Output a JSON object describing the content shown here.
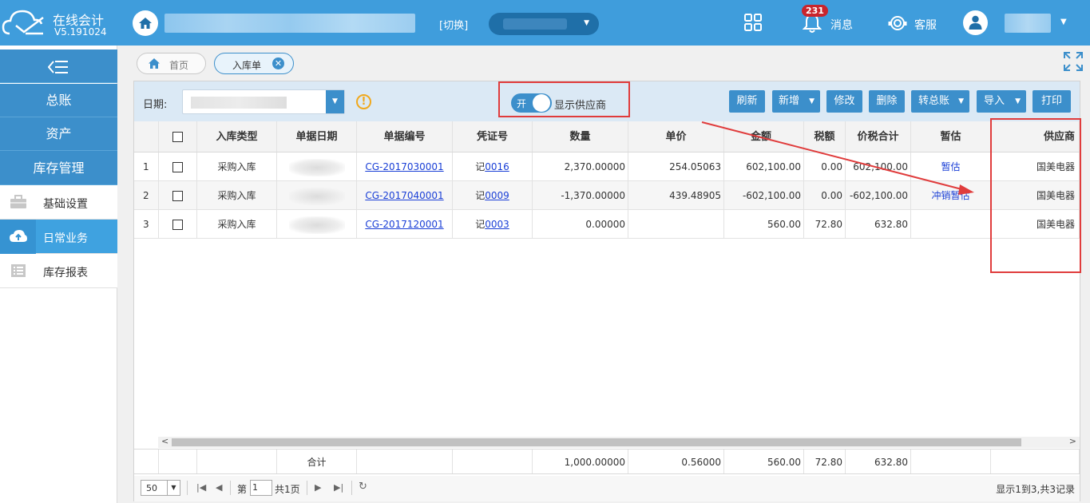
{
  "app": {
    "title": "在线会计",
    "version": "V5.191024"
  },
  "header": {
    "switch_label": "[切换]",
    "badge_count": "231",
    "messages_label": "消息",
    "service_label": "客服"
  },
  "sidebar": {
    "main_items": [
      "总账",
      "资产",
      "库存管理"
    ],
    "sub_items": [
      {
        "label": "基础设置",
        "icon": "briefcase-icon",
        "active": false
      },
      {
        "label": "日常业务",
        "icon": "cloud-upload-icon",
        "active": true
      },
      {
        "label": "库存报表",
        "icon": "report-list-icon",
        "active": false
      }
    ]
  },
  "tabs": [
    {
      "label": "首页",
      "icon": "home-icon"
    },
    {
      "label": "入库单",
      "active": true,
      "close_icon": "close-icon",
      "close_glyph": "✕"
    }
  ],
  "toolbar": {
    "date_label": "日期:",
    "warning_glyph": "!",
    "toggle_on_label": "开",
    "toggle_label": "显示供应商",
    "buttons": [
      {
        "label": "刷新"
      },
      {
        "label": "新增"
      },
      {
        "label": "修改"
      },
      {
        "label": "删除"
      },
      {
        "label": "转总账"
      },
      {
        "label": "导入"
      },
      {
        "label": "打印"
      }
    ]
  },
  "table": {
    "headers": [
      "入库类型",
      "单据日期",
      "单据编号",
      "凭证号",
      "数量",
      "单价",
      "金额",
      "税额",
      "价税合计",
      "暂估",
      "供应商"
    ],
    "rows": [
      {
        "num": "1",
        "type": "采购入库",
        "doc_no": "CG-2017030001",
        "voucher_prefix": "记",
        "voucher_no": "0016",
        "qty": "2,370.00000",
        "price": "254.05063",
        "amount": "602,100.00",
        "tax": "0.00",
        "total": "602,100.00",
        "estimate": "暂估",
        "supplier": "国美电器"
      },
      {
        "num": "2",
        "type": "采购入库",
        "doc_no": "CG-2017040001",
        "voucher_prefix": "记",
        "voucher_no": "0009",
        "qty": "-1,370.00000",
        "price": "439.48905",
        "amount": "-602,100.00",
        "tax": "0.00",
        "total": "-602,100.00",
        "estimate": "冲销暂估",
        "supplier": "国美电器"
      },
      {
        "num": "3",
        "type": "采购入库",
        "doc_no": "CG-2017120001",
        "voucher_prefix": "记",
        "voucher_no": "0003",
        "qty": "0.00000",
        "price": "",
        "amount": "560.00",
        "tax": "72.80",
        "total": "632.80",
        "estimate": "",
        "supplier": "国美电器"
      }
    ],
    "footer": {
      "label": "合计",
      "qty": "1,000.00000",
      "price": "0.56000",
      "amount": "560.00",
      "tax": "72.80",
      "total": "632.80"
    }
  },
  "pager": {
    "page_size": "50",
    "page_prefix": "第",
    "page_value": "1",
    "page_suffix": "共1页",
    "info": "显示1到3,共3记录"
  },
  "colors": {
    "header": "#3f9ddc",
    "accent": "#3c8fcb",
    "highlight": "#e03c3c",
    "badge": "#c9252c"
  }
}
